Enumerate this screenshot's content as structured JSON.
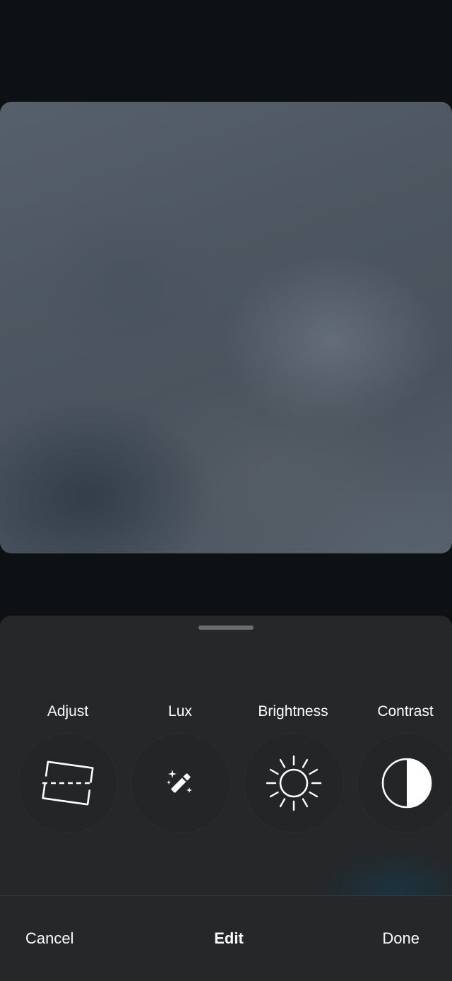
{
  "tools": {
    "adjust": {
      "label": "Adjust",
      "icon": "crop-rotate-icon"
    },
    "lux": {
      "label": "Lux",
      "icon": "magic-wand-icon"
    },
    "brightness": {
      "label": "Brightness",
      "icon": "sun-icon"
    },
    "contrast": {
      "label": "Contrast",
      "icon": "contrast-icon"
    }
  },
  "bottom_bar": {
    "cancel_label": "Cancel",
    "title": "Edit",
    "done_label": "Done"
  },
  "colors": {
    "background": "#0d1114",
    "sheet": "#252729",
    "text": "#ffffff"
  }
}
